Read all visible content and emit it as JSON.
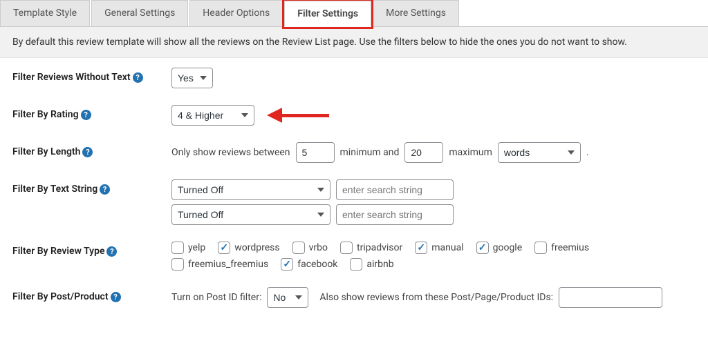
{
  "tabs": [
    "Template Style",
    "General Settings",
    "Header Options",
    "Filter Settings",
    "More Settings"
  ],
  "active_tab_index": 3,
  "highlight_tab_index": 3,
  "description": "By default this review template will show all the reviews on the Review List page. Use the filters below to hide the ones you do not want to show.",
  "rows": {
    "filter_without_text": {
      "label": "Filter Reviews Without Text",
      "value": "Yes"
    },
    "filter_by_rating": {
      "label": "Filter By Rating",
      "value": "4 & Higher"
    },
    "filter_by_length": {
      "label": "Filter By Length",
      "text_before": "Only show reviews between",
      "min_value": "5",
      "text_mid": "minimum and",
      "max_value": "20",
      "text_after": "maximum",
      "unit": "words",
      "period": "."
    },
    "filter_by_string": {
      "label": "Filter By Text String",
      "mode1": "Turned Off",
      "placeholder1": "enter search string",
      "mode2": "Turned Off",
      "placeholder2": "enter search string"
    },
    "filter_by_type": {
      "label": "Filter By Review Type",
      "options": [
        {
          "label": "yelp",
          "checked": false
        },
        {
          "label": "wordpress",
          "checked": true
        },
        {
          "label": "vrbo",
          "checked": false
        },
        {
          "label": "tripadvisor",
          "checked": false
        },
        {
          "label": "manual",
          "checked": true
        },
        {
          "label": "google",
          "checked": true
        },
        {
          "label": "freemius",
          "checked": false
        },
        {
          "label": "freemius_freemius",
          "checked": false
        },
        {
          "label": "facebook",
          "checked": true
        },
        {
          "label": "airbnb",
          "checked": false
        }
      ]
    },
    "filter_by_post": {
      "label": "Filter By Post/Product",
      "text1": "Turn on Post ID filter:",
      "toggle": "No",
      "text2": "Also show reviews from these Post/Page/Product IDs:",
      "ids_value": ""
    }
  }
}
